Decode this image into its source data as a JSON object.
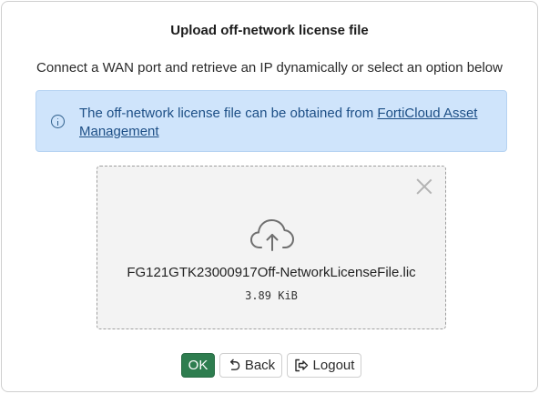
{
  "dialog": {
    "title": "Upload off-network license file",
    "subtitle": "Connect a WAN port and retrieve an IP dynamically or select an option below"
  },
  "info": {
    "icon": "info-icon",
    "text": "The off-network license file can be obtained from",
    "link_label": "FortiCloud Asset Management"
  },
  "upload": {
    "icon": "cloud-upload-icon",
    "file_name": "FG121GTK23000917Off-NetworkLicenseFile.lic",
    "file_size": "3.89 KiB"
  },
  "buttons": {
    "ok_label": "OK",
    "back_label": "Back",
    "back_icon": "undo-icon",
    "logout_label": "Logout",
    "logout_icon": "logout-icon"
  },
  "colors": {
    "info_background": "#cfe4fb",
    "info_text": "#1d4f86",
    "ok_button": "#2e7d4f",
    "dropzone_background": "#f3f3f3"
  }
}
